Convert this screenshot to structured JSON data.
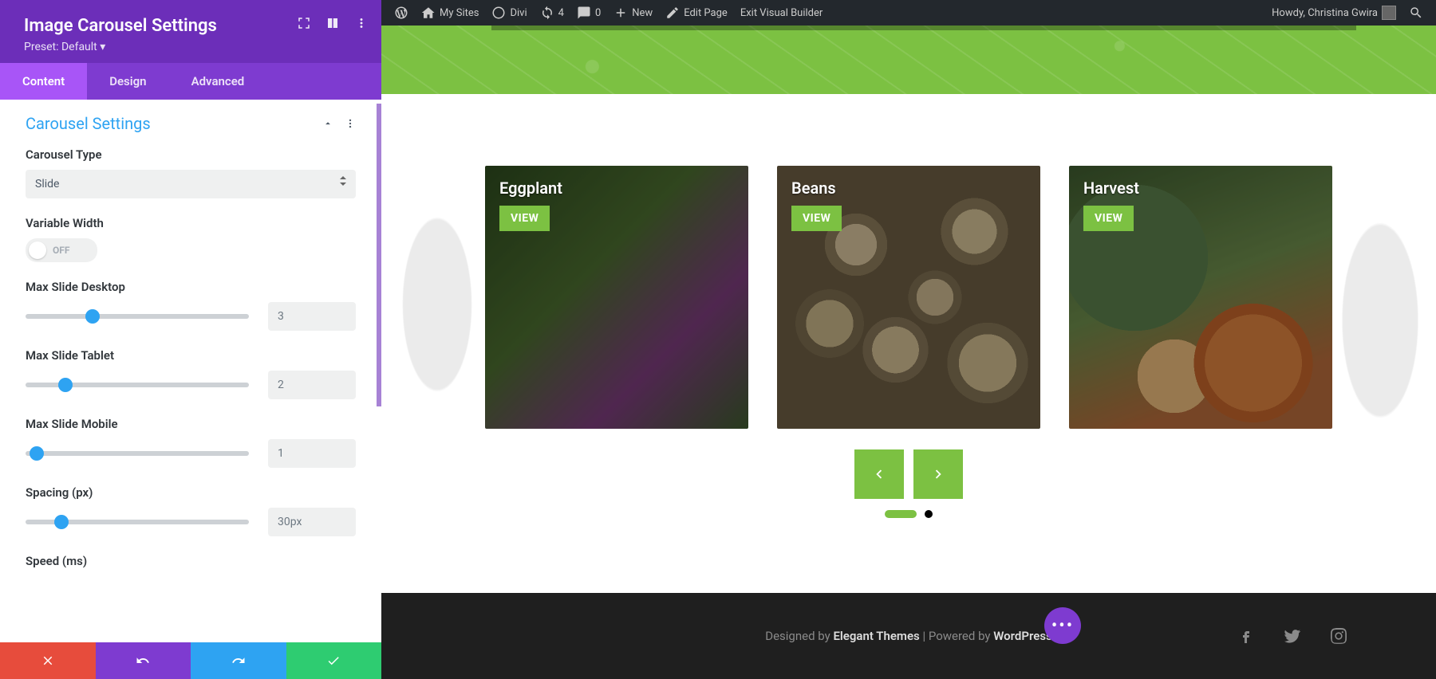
{
  "adminBar": {
    "mySites": "My Sites",
    "divi": "Divi",
    "refreshCount": "4",
    "commentCount": "0",
    "new": "New",
    "editPage": "Edit Page",
    "exitVB": "Exit Visual Builder",
    "greeting": "Howdy, Christina Gwira"
  },
  "panel": {
    "title": "Image Carousel Settings",
    "presetLabel": "Preset: Default",
    "tabs": {
      "content": "Content",
      "design": "Design",
      "advanced": "Advanced"
    },
    "groupTitle": "Carousel Settings",
    "fields": {
      "carouselType": {
        "label": "Carousel Type",
        "value": "Slide"
      },
      "variableWidth": {
        "label": "Variable Width",
        "state": "OFF"
      },
      "maxSlideDesktop": {
        "label": "Max Slide Desktop",
        "value": "3",
        "pct": 30
      },
      "maxSlideTablet": {
        "label": "Max Slide Tablet",
        "value": "2",
        "pct": 18
      },
      "maxSlideMobile": {
        "label": "Max Slide Mobile",
        "value": "1",
        "pct": 5
      },
      "spacing": {
        "label": "Spacing (px)",
        "value": "30px",
        "pct": 16
      },
      "speed": {
        "label": "Speed (ms)"
      }
    }
  },
  "cards": [
    {
      "title": "Eggplant",
      "btn": "VIEW",
      "bg": "bg-eggplant"
    },
    {
      "title": "Beans",
      "btn": "VIEW",
      "bg": "bg-beans"
    },
    {
      "title": "Harvest",
      "btn": "VIEW",
      "bg": "bg-harvest"
    }
  ],
  "footer": {
    "designedBy": "Designed by ",
    "themes": "Elegant Themes",
    "sep": " | ",
    "poweredBy": "Powered by ",
    "wp": "WordPress"
  }
}
